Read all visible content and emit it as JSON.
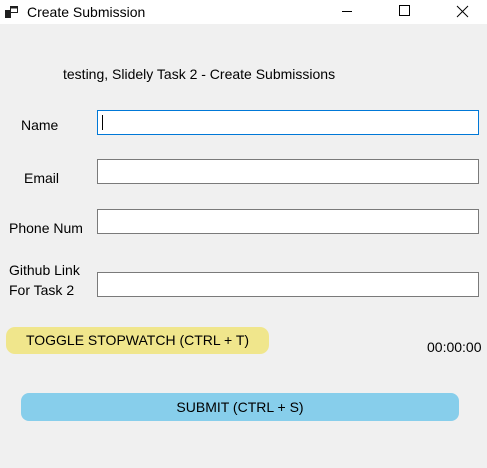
{
  "window": {
    "title": "Create Submission",
    "icon": "app-window-icon",
    "controls": [
      "minimize-icon",
      "maximize-icon",
      "close-icon"
    ]
  },
  "header": {
    "text": "testing, Slidely Task 2 - Create Submissions"
  },
  "form": {
    "fields": [
      {
        "label": "Name",
        "value": ""
      },
      {
        "label": "Email",
        "value": ""
      },
      {
        "label": "Phone Num",
        "value": ""
      },
      {
        "label_line1": "Github Link",
        "label_line2": "For Task 2",
        "value": ""
      }
    ]
  },
  "stopwatch": {
    "toggle_label": "TOGGLE STOPWATCH (CTRL + T)",
    "toggle_color": "#f0e68c",
    "time": "00:00:00"
  },
  "submit": {
    "label": "SUBMIT (CTRL + S)",
    "color": "#87ceeb"
  }
}
